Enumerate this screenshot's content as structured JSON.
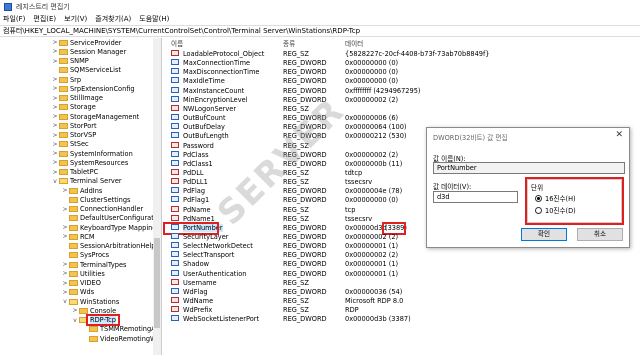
{
  "window": {
    "title": "레지스트리 편집기"
  },
  "menu": [
    "파일(F)",
    "편집(E)",
    "보기(V)",
    "즐겨찾기(A)",
    "도움말(H)"
  ],
  "address": "컴퓨터\\HKEY_LOCAL_MACHINE\\SYSTEM\\CurrentControlSet\\Control\\Terminal Server\\WinStations\\RDP-Tcp",
  "tree": [
    {
      "label": "ServiceProvider",
      "indent": 0,
      "exp": ">"
    },
    {
      "label": "Session Manager",
      "indent": 0,
      "exp": ">"
    },
    {
      "label": "SNMP",
      "indent": 0,
      "exp": ">"
    },
    {
      "label": "SQMServiceList",
      "indent": 0,
      "exp": ""
    },
    {
      "label": "Srp",
      "indent": 0,
      "exp": ">"
    },
    {
      "label": "SrpExtensionConfig",
      "indent": 0,
      "exp": ">"
    },
    {
      "label": "StillImage",
      "indent": 0,
      "exp": ">"
    },
    {
      "label": "Storage",
      "indent": 0,
      "exp": ">"
    },
    {
      "label": "StorageManagement",
      "indent": 0,
      "exp": ">"
    },
    {
      "label": "StorPort",
      "indent": 0,
      "exp": ">"
    },
    {
      "label": "StorVSP",
      "indent": 0,
      "exp": ">"
    },
    {
      "label": "StSec",
      "indent": 0,
      "exp": ">"
    },
    {
      "label": "SystemInformation",
      "indent": 0,
      "exp": ">"
    },
    {
      "label": "SystemResources",
      "indent": 0,
      "exp": ">"
    },
    {
      "label": "TabletPC",
      "indent": 0,
      "exp": ">"
    },
    {
      "label": "Terminal Server",
      "indent": 0,
      "exp": "v"
    },
    {
      "label": "AddIns",
      "indent": 1,
      "exp": ">"
    },
    {
      "label": "ClusterSettings",
      "indent": 1,
      "exp": ""
    },
    {
      "label": "ConnectionHandler",
      "indent": 1,
      "exp": ">"
    },
    {
      "label": "DefaultUserConfiguration",
      "indent": 1,
      "exp": ""
    },
    {
      "label": "KeyboardType Mapping",
      "indent": 1,
      "exp": ">"
    },
    {
      "label": "RCM",
      "indent": 1,
      "exp": ">"
    },
    {
      "label": "SessionArbitrationHelper",
      "indent": 1,
      "exp": ""
    },
    {
      "label": "SysProcs",
      "indent": 1,
      "exp": ""
    },
    {
      "label": "TerminalTypes",
      "indent": 1,
      "exp": ">"
    },
    {
      "label": "Utilities",
      "indent": 1,
      "exp": ">"
    },
    {
      "label": "VIDEO",
      "indent": 1,
      "exp": ">"
    },
    {
      "label": "Wds",
      "indent": 1,
      "exp": ">"
    },
    {
      "label": "WinStations",
      "indent": 1,
      "exp": "v"
    },
    {
      "label": "Console",
      "indent": 2,
      "exp": ">"
    },
    {
      "label": "RDP-Tcp",
      "indent": 2,
      "exp": "v",
      "selected": true
    },
    {
      "label": "TSMMRemotingAllow",
      "indent": 3,
      "exp": ""
    },
    {
      "label": "VideoRemotingWindo",
      "indent": 3,
      "exp": ""
    }
  ],
  "columns": {
    "name": "이름",
    "type": "종류",
    "data": "데이터"
  },
  "values": [
    {
      "name": "LoadableProtocol_Object",
      "type": "REG_SZ",
      "data": "{5828227c-20cf-4408-b73f-73ab70b8849f}",
      "kind": "str"
    },
    {
      "name": "MaxConnectionTime",
      "type": "REG_DWORD",
      "data": "0x00000000 (0)",
      "kind": "bin"
    },
    {
      "name": "MaxDisconnectionTime",
      "type": "REG_DWORD",
      "data": "0x00000000 (0)",
      "kind": "bin"
    },
    {
      "name": "MaxIdleTime",
      "type": "REG_DWORD",
      "data": "0x00000000 (0)",
      "kind": "bin"
    },
    {
      "name": "MaxInstanceCount",
      "type": "REG_DWORD",
      "data": "0xffffffff (4294967295)",
      "kind": "bin"
    },
    {
      "name": "MinEncryptionLevel",
      "type": "REG_DWORD",
      "data": "0x00000002 (2)",
      "kind": "bin"
    },
    {
      "name": "NWLogonServer",
      "type": "REG_SZ",
      "data": "",
      "kind": "str"
    },
    {
      "name": "OutBufCount",
      "type": "REG_DWORD",
      "data": "0x00000006 (6)",
      "kind": "bin"
    },
    {
      "name": "OutBufDelay",
      "type": "REG_DWORD",
      "data": "0x00000064 (100)",
      "kind": "bin"
    },
    {
      "name": "OutBufLength",
      "type": "REG_DWORD",
      "data": "0x00000212 (530)",
      "kind": "bin"
    },
    {
      "name": "Password",
      "type": "REG_SZ",
      "data": "",
      "kind": "str"
    },
    {
      "name": "PdClass",
      "type": "REG_DWORD",
      "data": "0x00000002 (2)",
      "kind": "bin"
    },
    {
      "name": "PdClass1",
      "type": "REG_DWORD",
      "data": "0x0000000b (11)",
      "kind": "bin"
    },
    {
      "name": "PdDLL",
      "type": "REG_SZ",
      "data": "tdtcp",
      "kind": "str"
    },
    {
      "name": "PdDLL1",
      "type": "REG_SZ",
      "data": "tssecsrv",
      "kind": "str"
    },
    {
      "name": "PdFlag",
      "type": "REG_DWORD",
      "data": "0x0000004e (78)",
      "kind": "bin"
    },
    {
      "name": "PdFlag1",
      "type": "REG_DWORD",
      "data": "0x00000000 (0)",
      "kind": "bin"
    },
    {
      "name": "PdName",
      "type": "REG_SZ",
      "data": "tcp",
      "kind": "str"
    },
    {
      "name": "PdName1",
      "type": "REG_SZ",
      "data": "tssecsrv",
      "kind": "str"
    },
    {
      "name": "PortNumber",
      "type": "REG_DWORD",
      "data": "0x00000d3d",
      "data2": "(3389)",
      "kind": "bin",
      "highlight": true
    },
    {
      "name": "SecurityLayer",
      "type": "REG_DWORD",
      "data": "0x00000002 (2)",
      "kind": "bin"
    },
    {
      "name": "SelectNetworkDetect",
      "type": "REG_DWORD",
      "data": "0x00000001 (1)",
      "kind": "bin"
    },
    {
      "name": "SelectTransport",
      "type": "REG_DWORD",
      "data": "0x00000002 (2)",
      "kind": "bin"
    },
    {
      "name": "Shadow",
      "type": "REG_DWORD",
      "data": "0x00000001 (1)",
      "kind": "bin"
    },
    {
      "name": "UserAuthentication",
      "type": "REG_DWORD",
      "data": "0x00000001 (1)",
      "kind": "bin"
    },
    {
      "name": "Username",
      "type": "REG_SZ",
      "data": "",
      "kind": "str"
    },
    {
      "name": "WdFlag",
      "type": "REG_DWORD",
      "data": "0x00000036 (54)",
      "kind": "bin"
    },
    {
      "name": "WdName",
      "type": "REG_SZ",
      "data": "Microsoft RDP 8.0",
      "kind": "str"
    },
    {
      "name": "WdPrefix",
      "type": "REG_SZ",
      "data": "RDP",
      "kind": "str"
    },
    {
      "name": "WebSocketListenerPort",
      "type": "REG_DWORD",
      "data": "0x00000d3b (3387)",
      "kind": "bin"
    }
  ],
  "dialog": {
    "title": "DWORD(32비트) 값 편집",
    "close": "✕",
    "name_label": "값 이름(N):",
    "name_value": "PortNumber",
    "data_label": "값 데이터(V):",
    "data_value": "d3d",
    "base_label": "단위",
    "hex_label": "16진수(H)",
    "dec_label": "10진수(D)",
    "base_selected": "hex",
    "ok": "확인",
    "cancel": "취소"
  },
  "watermark": "SERVER"
}
